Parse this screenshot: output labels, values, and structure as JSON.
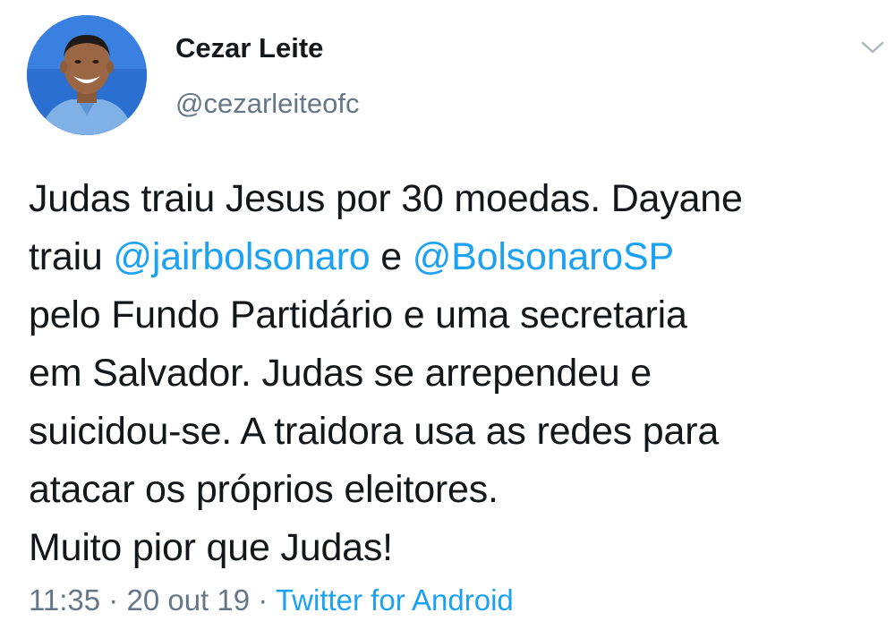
{
  "author": {
    "name": "Cezar Leite",
    "handle": "@cezarleiteofc"
  },
  "tweet": {
    "line1": "Judas traiu Jesus por 30 moedas. Dayane",
    "line2_pre": "traiu ",
    "mention1": "@jairbolsonaro",
    "line2_mid": " e ",
    "mention2": "@BolsonaroSP",
    "line3": "pelo Fundo Partidário e uma secretaria",
    "line4": "em Salvador. Judas se arrependeu e",
    "line5": "suicidou-se. A traidora usa as redes para",
    "line6": "atacar os próprios eleitores.",
    "line7": "Muito pior que Judas!"
  },
  "meta": {
    "time": "11:35",
    "sep1": " · ",
    "date": "20 out 19",
    "sep2": " · ",
    "source": "Twitter for Android"
  },
  "icons": {
    "menu": "chevron-down-icon"
  },
  "colors": {
    "link": "#1da1f2",
    "secondary": "#657786",
    "text": "#14171a",
    "avatar_bg": "#2b69c9"
  }
}
